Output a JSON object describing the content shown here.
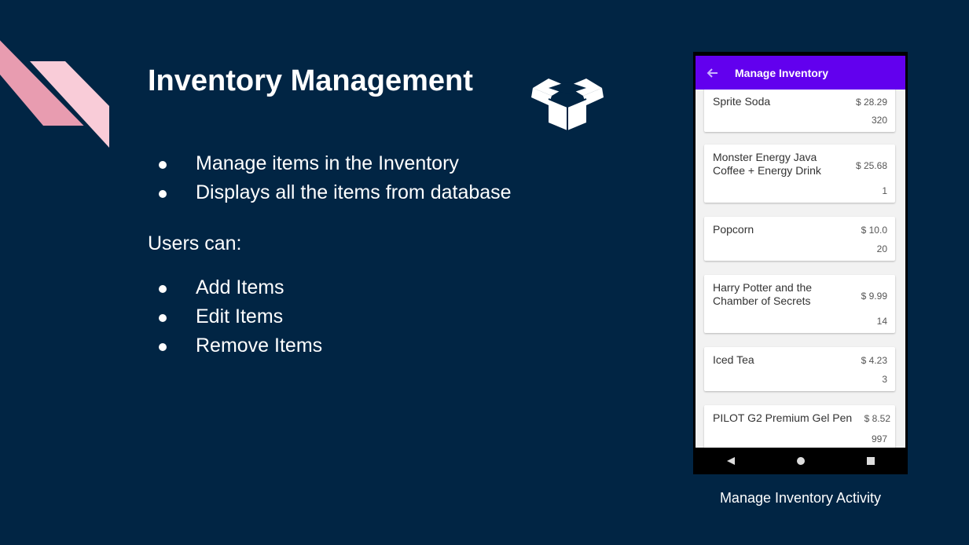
{
  "slide": {
    "title": "Inventory Management",
    "features": [
      "Manage items in the Inventory",
      "Displays all the items from database"
    ],
    "users_label": "Users can:",
    "actions": [
      "Add Items",
      "Edit Items",
      "Remove Items"
    ],
    "caption": "Manage Inventory Activity"
  },
  "colors": {
    "background": "#012544",
    "accent_pink": "#e89cb0",
    "accent_light_pink": "#f9ccd8",
    "app_bar": "#6200ee"
  },
  "icons": {
    "box": "open-box-icon",
    "back": "arrow-back-icon",
    "nav_back": "triangle-back-icon",
    "nav_home": "circle-home-icon",
    "nav_recents": "square-recents-icon"
  },
  "phone": {
    "app_bar_title": "Manage Inventory",
    "items": [
      {
        "name": "Sprite Soda",
        "price": "$ 28.29",
        "qty": "320"
      },
      {
        "name": "Monster Energy Java Coffee + Energy Drink",
        "price": "$ 25.68",
        "qty": "1"
      },
      {
        "name": "Popcorn",
        "price": "$ 10.0",
        "qty": "20"
      },
      {
        "name": "Harry Potter and the Chamber of Secrets",
        "price": "$ 9.99",
        "qty": "14"
      },
      {
        "name": "Iced Tea",
        "price": "$ 4.23",
        "qty": "3"
      },
      {
        "name": "PILOT G2 Premium Gel Pen",
        "price": "$ 8.52",
        "qty": "997"
      }
    ]
  }
}
